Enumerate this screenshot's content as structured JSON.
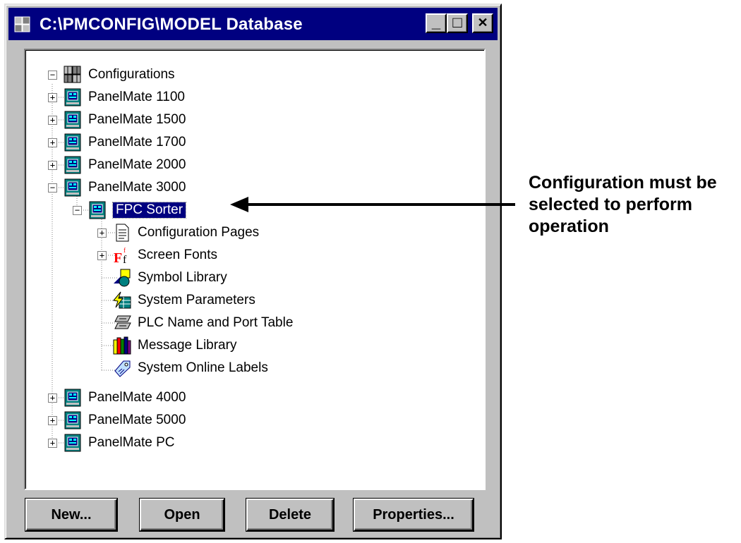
{
  "window": {
    "title": "C:\\PMCONFIG\\MODEL Database",
    "minimize": "_",
    "maximize": "□",
    "close": "✕"
  },
  "tree": {
    "root": {
      "label": "Configurations",
      "icon": "configurations-cube-icon"
    },
    "configs_before": [
      {
        "label": "PanelMate 1100"
      },
      {
        "label": "PanelMate 1500"
      },
      {
        "label": "PanelMate 1700"
      },
      {
        "label": "PanelMate 2000"
      },
      {
        "label": "PanelMate 3000"
      }
    ],
    "selected": {
      "label": "FPC Sorter"
    },
    "children": [
      {
        "label": "Configuration Pages",
        "icon": "document-icon"
      },
      {
        "label": "Screen Fonts",
        "icon": "fonts-icon"
      },
      {
        "label": "Symbol Library",
        "icon": "symbol-library-icon"
      },
      {
        "label": "System Parameters",
        "icon": "system-parameters-icon"
      },
      {
        "label": "PLC Name and Port Table",
        "icon": "plc-table-icon"
      },
      {
        "label": "Message Library",
        "icon": "message-library-icon"
      },
      {
        "label": "System Online Labels",
        "icon": "online-labels-icon"
      }
    ],
    "configs_after": [
      {
        "label": "PanelMate 4000"
      },
      {
        "label": "PanelMate 5000"
      },
      {
        "label": "PanelMate PC"
      }
    ]
  },
  "buttons": {
    "new": "New...",
    "open": "Open",
    "delete": "Delete",
    "properties": "Properties..."
  },
  "callout": {
    "line1": "Configuration must be",
    "line2": "selected to perform",
    "line3": "operation"
  },
  "colors": {
    "titlebar": "#000080",
    "selection": "#000080",
    "window_face": "#c0c0c0"
  }
}
